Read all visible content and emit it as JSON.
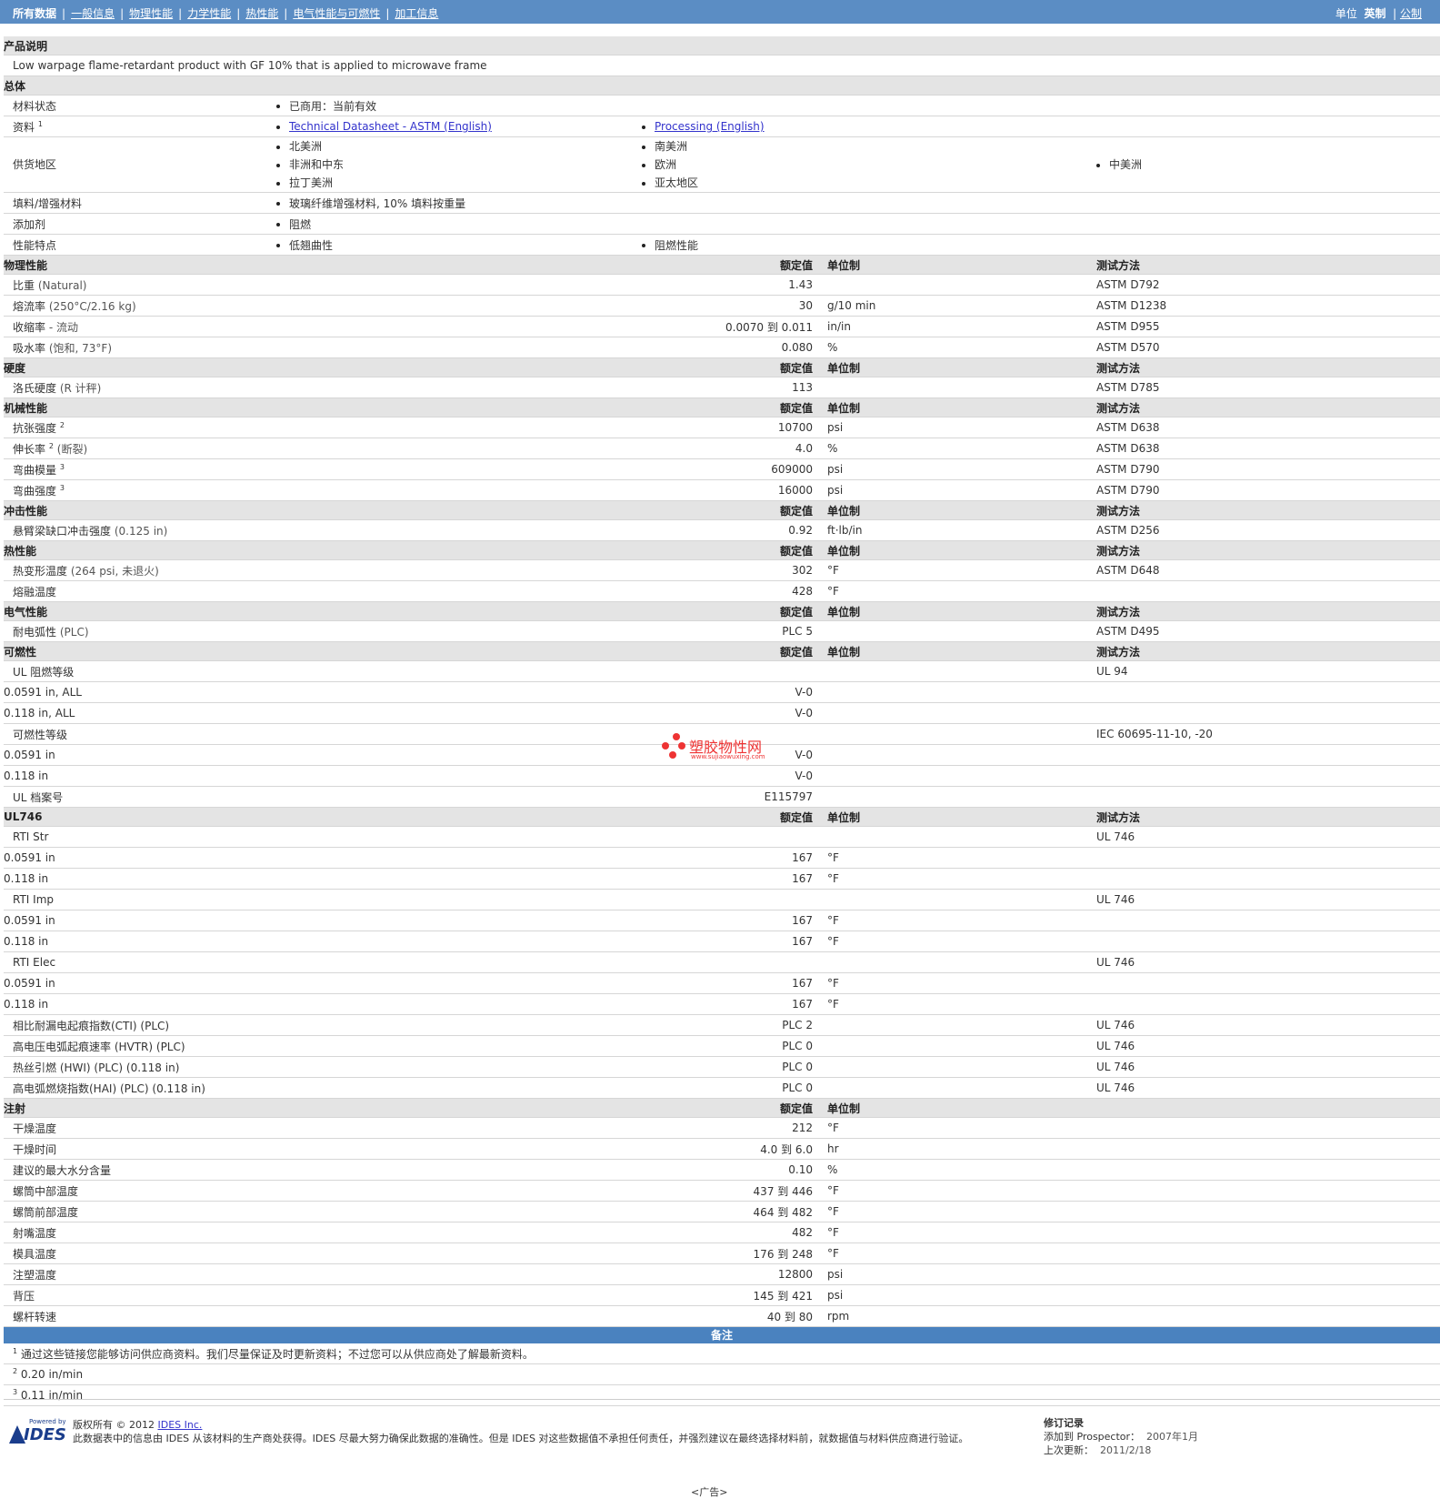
{
  "nav": {
    "all_data": "所有数据",
    "general": "一般信息",
    "physical": "物理性能",
    "mechanical": "力学性能",
    "thermal": "热性能",
    "electrical": "电气性能与可燃性",
    "processing": "加工信息",
    "units_label": "单位",
    "units_english": "英制",
    "units_metric": "公制"
  },
  "product": {
    "header": "产品说明",
    "description": "Low warpage flame-retardant product with GF 10% that is applied to microwave frame"
  },
  "general": {
    "header": "总体",
    "material_status_label": "材料状态",
    "material_status": "已商用：当前有效",
    "docs_label": "资料",
    "docs_sup": "1",
    "doc1": "Technical Datasheet - ASTM (English)",
    "doc2": "Processing (English)",
    "regions_label": "供货地区",
    "regions": [
      "北美洲",
      "非洲和中东",
      "拉丁美洲",
      "南美洲",
      "欧洲",
      "亚太地区",
      "中美洲"
    ],
    "filler_label": "填料/增强材料",
    "filler": "玻璃纤维增强材料, 10% 填料按重量",
    "additive_label": "添加剂",
    "additive": "阻燃",
    "features_label": "性能特点",
    "feature1": "低翘曲性",
    "feature2": "阻燃性能"
  },
  "cols": {
    "nominal": "额定值",
    "unit": "单位制",
    "method": "测试方法"
  },
  "physical": {
    "header": "物理性能",
    "rows": [
      {
        "name": "比重",
        "cond": "(Natural)",
        "val": "1.43",
        "unit": "",
        "method": "ASTM D792"
      },
      {
        "name": "熔流率",
        "cond": "(250°C/2.16 kg)",
        "val": "30",
        "unit": "g/10 min",
        "method": "ASTM D1238"
      },
      {
        "name": "收缩率",
        "cond": "- 流动",
        "val": "0.0070 到  0.011",
        "unit": "in/in",
        "method": "ASTM D955"
      },
      {
        "name": "吸水率",
        "cond": "(饱和, 73°F)",
        "val": "0.080",
        "unit": "%",
        "method": "ASTM D570"
      }
    ]
  },
  "hardness": {
    "header": "硬度",
    "rows": [
      {
        "name": "洛氏硬度",
        "cond": "(R 计秤)",
        "val": "113",
        "unit": "",
        "method": "ASTM D785"
      }
    ]
  },
  "mechanical": {
    "header": "机械性能",
    "rows": [
      {
        "name": "抗张强度",
        "sup": "2",
        "cond": "",
        "val": "10700",
        "unit": "psi",
        "method": "ASTM D638"
      },
      {
        "name": "伸长率",
        "sup": "2",
        "cond": "(断裂)",
        "val": "4.0",
        "unit": "%",
        "method": "ASTM D638"
      },
      {
        "name": "弯曲模量",
        "sup": "3",
        "cond": "",
        "val": "609000",
        "unit": "psi",
        "method": "ASTM D790"
      },
      {
        "name": "弯曲强度",
        "sup": "3",
        "cond": "",
        "val": "16000",
        "unit": "psi",
        "method": "ASTM D790"
      }
    ]
  },
  "impact": {
    "header": "冲击性能",
    "rows": [
      {
        "name": "悬臂梁缺口冲击强度",
        "cond": "(0.125 in)",
        "val": "0.92",
        "unit": "ft·lb/in",
        "method": "ASTM D256"
      }
    ]
  },
  "thermal": {
    "header": "热性能",
    "rows": [
      {
        "name": "热变形温度",
        "cond": "(264 psi, 未退火)",
        "val": "302",
        "unit": "°F",
        "method": "ASTM D648"
      },
      {
        "name": "熔融温度",
        "cond": "",
        "val": "428",
        "unit": "°F",
        "method": ""
      }
    ]
  },
  "electrical": {
    "header": "电气性能",
    "rows": [
      {
        "name": "耐电弧性",
        "cond": "(PLC)",
        "val": "PLC 5",
        "unit": "",
        "method": "ASTM D495"
      }
    ]
  },
  "flammability": {
    "header": "可燃性",
    "ul_label": "UL 阻燃等级",
    "ul_method": "UL 94",
    "ul_rows": [
      {
        "name": "0.0591 in, ALL",
        "val": "V-0"
      },
      {
        "name": "0.118 in, ALL",
        "val": "V-0"
      }
    ],
    "flam_label": "可燃性等级",
    "flam_method": "IEC 60695-11-10, -20",
    "flam_rows": [
      {
        "name": "0.0591 in",
        "val": "V-0"
      },
      {
        "name": "0.118 in",
        "val": "V-0"
      }
    ],
    "file_label": "UL 档案号",
    "file_val": "E115797"
  },
  "watermark": {
    "text": "塑胶物性网",
    "url": "www.sujiaowuxing.com"
  },
  "ul746": {
    "header": "UL746",
    "groups": [
      {
        "name": "RTI Str",
        "method": "UL 746",
        "rows": [
          {
            "name": "0.0591 in",
            "val": "167",
            "unit": "°F"
          },
          {
            "name": "0.118 in",
            "val": "167",
            "unit": "°F"
          }
        ]
      },
      {
        "name": "RTI Imp",
        "method": "UL 746",
        "rows": [
          {
            "name": "0.0591 in",
            "val": "167",
            "unit": "°F"
          },
          {
            "name": "0.118 in",
            "val": "167",
            "unit": "°F"
          }
        ]
      },
      {
        "name": "RTI Elec",
        "method": "UL 746",
        "rows": [
          {
            "name": "0.0591 in",
            "val": "167",
            "unit": "°F"
          },
          {
            "name": "0.118 in",
            "val": "167",
            "unit": "°F"
          }
        ]
      }
    ],
    "rows": [
      {
        "name": "相比耐漏电起痕指数(CTI) (PLC)",
        "val": "PLC 2",
        "method": "UL 746"
      },
      {
        "name": "高电压电弧起痕速率 (HVTR) (PLC)",
        "val": "PLC 0",
        "method": "UL 746"
      },
      {
        "name": "热丝引燃 (HWI) (PLC) (0.118 in)",
        "val": "PLC 0",
        "method": "UL 746"
      },
      {
        "name": "高电弧燃烧指数(HAI) (PLC) (0.118 in)",
        "val": "PLC 0",
        "method": "UL 746"
      }
    ]
  },
  "injection": {
    "header": "注射",
    "rows": [
      {
        "name": "干燥温度",
        "val": "212",
        "unit": "°F"
      },
      {
        "name": "干燥时间",
        "val": "4.0 到  6.0",
        "unit": "hr"
      },
      {
        "name": "建议的最大水分含量",
        "val": "0.10",
        "unit": "%"
      },
      {
        "name": "螺筒中部温度",
        "val": "437 到  446",
        "unit": "°F"
      },
      {
        "name": "螺筒前部温度",
        "val": "464 到  482",
        "unit": "°F"
      },
      {
        "name": "射嘴温度",
        "val": "482",
        "unit": "°F"
      },
      {
        "name": "模具温度",
        "val": "176 到  248",
        "unit": "°F"
      },
      {
        "name": "注塑温度",
        "val": "12800",
        "unit": "psi"
      },
      {
        "name": "背压",
        "val": "145 到  421",
        "unit": "psi"
      },
      {
        "name": "螺杆转速",
        "val": "40 到  80",
        "unit": "rpm"
      }
    ]
  },
  "notes": {
    "header": "备注",
    "items": [
      {
        "sup": "1",
        "text": "通过这些链接您能够访问供应商资料。我们尽量保证及时更新资料；不过您可以从供应商处了解最新资料。"
      },
      {
        "sup": "2",
        "text": "0.20 in/min"
      },
      {
        "sup": "3",
        "text": "0.11 in/min"
      }
    ]
  },
  "footer": {
    "powered": "Powered by",
    "logo": "IDES",
    "copyright_prefix": "版权所有 © 2012",
    "company": "IDES Inc.",
    "disclaimer": "此数据表中的信息由 IDES 从该材料的生产商处获得。IDES 尽最大努力确保此数据的准确性。但是 IDES 对这些数据值不承担任何责任，并强烈建议在最终选择材料前，就数据值与材料供应商进行验证。",
    "rev_title": "修订记录",
    "added_label": "添加到 Prospector：",
    "added_val": "2007年1月",
    "updated_label": "上次更新：",
    "updated_val": "2011/2/18",
    "ad": "<广告>"
  }
}
